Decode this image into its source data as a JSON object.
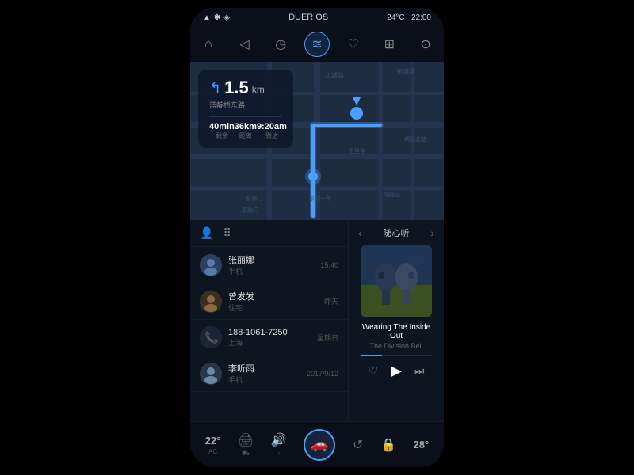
{
  "status": {
    "wifi": "📶",
    "bluetooth": "⬡",
    "device": "DUER OS",
    "temp": "24°C",
    "time": "22:00"
  },
  "nav_icons": [
    {
      "name": "home",
      "symbol": "⌂",
      "active": false
    },
    {
      "name": "navigation",
      "symbol": "◁",
      "active": false
    },
    {
      "name": "history",
      "symbol": "◷",
      "active": false
    },
    {
      "name": "voice",
      "symbol": "≋",
      "active": true
    },
    {
      "name": "person",
      "symbol": "♡",
      "active": false
    },
    {
      "name": "apps",
      "symbol": "⊞",
      "active": false
    },
    {
      "name": "profile",
      "symbol": "⊙",
      "active": false
    }
  ],
  "navigation": {
    "distance": "1.5",
    "unit": "km",
    "road": "蓝靛桥东路",
    "time_remaining": "40min",
    "time_label": "剩余",
    "distance_remaining": "36km",
    "distance_label": "距离",
    "arrival": "9:20am",
    "arrival_label": "到达"
  },
  "panel_icons": {
    "person": "👤",
    "grid": "⠿"
  },
  "contacts": [
    {
      "name": "张丽娜",
      "sub": "手机",
      "time": "15:40",
      "avatar": "👩"
    },
    {
      "name": "曾发发",
      "sub": "住宅",
      "time": "昨天",
      "avatar": "👨"
    },
    {
      "name": "188-1061-7250",
      "sub": "上海",
      "time": "星期日",
      "avatar": "📞"
    },
    {
      "name": "李听雨",
      "sub": "手机",
      "time": "2017/9/12",
      "avatar": "👤"
    }
  ],
  "music": {
    "header": "随心听",
    "song": "Wearing The Inside Out",
    "artist": "The Division Bell",
    "progress": 30
  },
  "bottom_bar": {
    "left_temp": "22°",
    "left_label": "AC",
    "icons": [
      "🖨",
      "🔊",
      "🚗",
      "↺",
      "🔒",
      "⌀"
    ],
    "right_temp": "28°"
  }
}
